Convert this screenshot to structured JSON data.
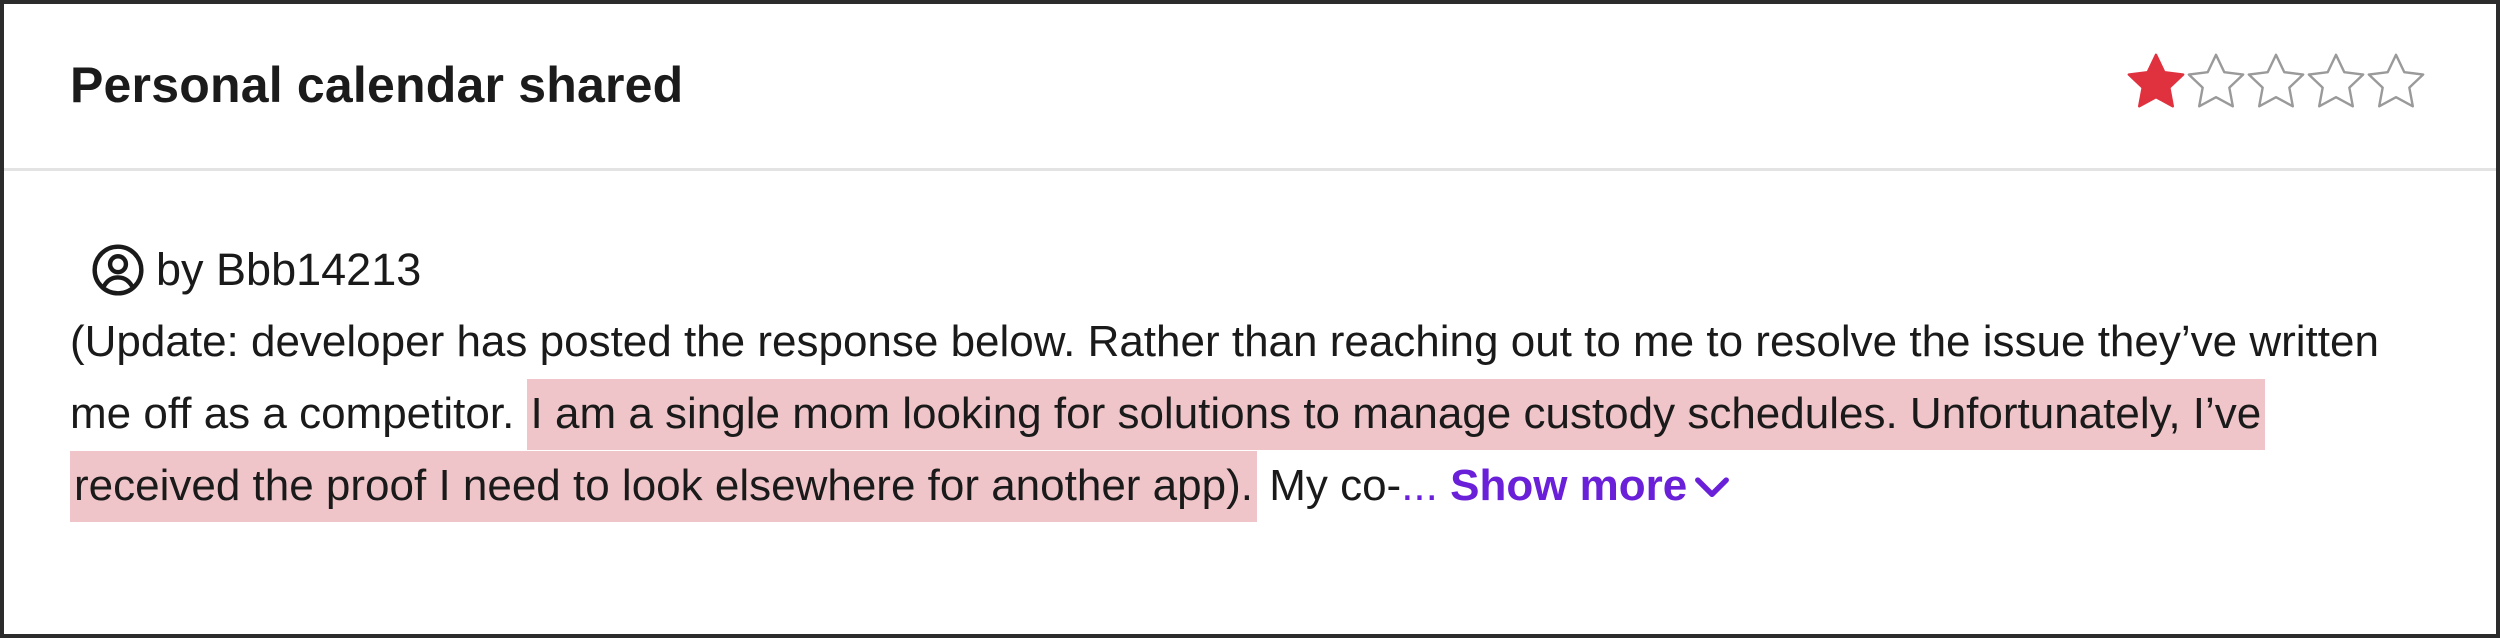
{
  "review": {
    "title": "Personal calendar shared",
    "rating": 1,
    "max_rating": 5,
    "author_prefix": "by",
    "author_name": "Bbb14213",
    "text_before": "(Update: developer has posted the response below. Rather than reaching out to me to resolve the issue they’ve written me off as a competitor. ",
    "text_highlighted": "I am a single mom looking for solutions to manage custody schedules. Unfortunately, I’ve received the proof I need to look elsewhere for another app).",
    "text_after": " My co-",
    "ellipsis": "...",
    "show_more_label": "Show more",
    "highlight_color": "#f0c5c9",
    "star_filled_color": "#e0313f",
    "accent_color": "#6a1fd8",
    "icons": {
      "author": "user-circle-icon",
      "show_more": "chevron-down-icon"
    }
  }
}
